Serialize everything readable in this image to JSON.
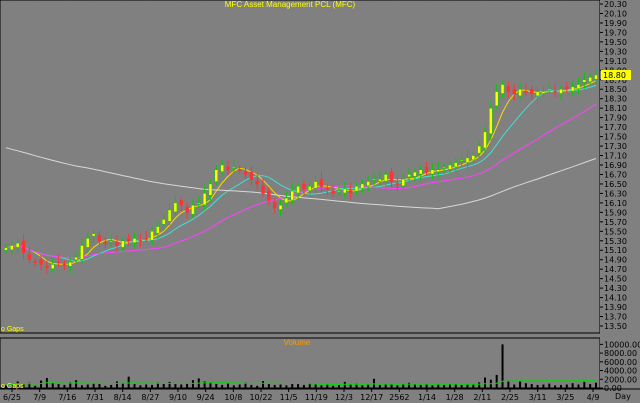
{
  "chart_data": {
    "type": "candlestick",
    "title": "MFC Asset Management PCL (MFC)",
    "price_panel": {
      "ylim": [
        13.5,
        20.3
      ],
      "yticks": [
        "20.30",
        "20.10",
        "19.90",
        "19.70",
        "19.50",
        "19.30",
        "19.10",
        "18.90",
        "18.70",
        "18.50",
        "18.30",
        "18.10",
        "17.90",
        "17.70",
        "17.50",
        "17.30",
        "17.10",
        "16.90",
        "16.70",
        "16.50",
        "16.30",
        "16.10",
        "15.90",
        "15.70",
        "15.50",
        "15.30",
        "15.10",
        "14.90",
        "14.70",
        "14.50",
        "14.30",
        "14.10",
        "13.90",
        "13.70",
        "13.50"
      ],
      "last_price": "18.80",
      "note": "o Gaps",
      "series": [
        {
          "name": "",
          "color": "#ffff00",
          "kind": "candles",
          "values": [
            15.15,
            15.2,
            15.25,
            15.05,
            14.9,
            14.85,
            14.8,
            14.75,
            14.8,
            14.85,
            14.8,
            14.85,
            14.95,
            15.2,
            15.35,
            15.45,
            15.3,
            15.25,
            15.3,
            15.2,
            15.3,
            15.3,
            15.35,
            15.3,
            15.35,
            15.5,
            15.6,
            15.75,
            15.95,
            16.1,
            16.05,
            15.9,
            16.05,
            16.1,
            16.3,
            16.5,
            16.8,
            16.9,
            16.8,
            16.85,
            16.8,
            16.7,
            16.6,
            16.5,
            16.3,
            16.15,
            16.0,
            16.05,
            16.2,
            16.35,
            16.45,
            16.4,
            16.45,
            16.55,
            16.45,
            16.4,
            16.3,
            16.35,
            16.4,
            16.3,
            16.45,
            16.5,
            16.55,
            16.6,
            16.6,
            16.7,
            16.55,
            16.5,
            16.6,
            16.7,
            16.75,
            16.8,
            16.75,
            16.8,
            16.8,
            16.85,
            16.9,
            16.95,
            17.0,
            17.05,
            17.1,
            17.3,
            17.6,
            18.1,
            18.45,
            18.6,
            18.45,
            18.4,
            18.5,
            18.45,
            18.4,
            18.45,
            18.45,
            18.5,
            18.45,
            18.5,
            18.5,
            18.55,
            18.6,
            18.7,
            18.75,
            18.8
          ]
        },
        {
          "name": "",
          "color": "#ffd700",
          "kind": "ma",
          "values": []
        },
        {
          "name": "",
          "color": "#40e0d0",
          "kind": "ma",
          "values": []
        },
        {
          "name": "",
          "color": "#ff40ff",
          "kind": "ma",
          "values": []
        },
        {
          "name": "",
          "color": "#d8d8d8",
          "kind": "ma",
          "values": []
        }
      ]
    },
    "volume_panel": {
      "title": "Volume",
      "ylim": [
        0,
        11000
      ],
      "yticks": [
        "10000.00",
        "8000.00",
        "6000.00",
        "4000.00",
        "2000.00",
        "0.00"
      ],
      "note": "o Gaps",
      "values": [
        600,
        900,
        1500,
        800,
        1200,
        500,
        1700,
        2300,
        1100,
        900,
        700,
        1300,
        1800,
        600,
        800,
        1000,
        900,
        500,
        700,
        1500,
        1100,
        2600,
        900,
        600,
        800,
        700,
        1200,
        1000,
        1400,
        900,
        800,
        1100,
        1800,
        2200,
        1500,
        1300,
        900,
        700,
        1000,
        600,
        800,
        1200,
        700,
        500,
        1600,
        900,
        700,
        800,
        600,
        1000,
        900,
        700,
        1100,
        800,
        600,
        900,
        500,
        700,
        1400,
        900,
        1000,
        600,
        800,
        2100,
        700,
        900,
        800,
        600,
        900,
        1200,
        800,
        700,
        900,
        600,
        800,
        700,
        900,
        1000,
        700,
        800,
        900,
        1300,
        2400,
        1900,
        3000,
        10000,
        1700,
        800,
        1500,
        1100,
        900,
        700,
        800,
        1000,
        600,
        700,
        800,
        1100,
        800,
        1400,
        900,
        1200
      ]
    },
    "x_axis": {
      "label_right": "Day",
      "tick_labels": [
        "6/25",
        "7/9",
        "7/16",
        "7/31",
        "8/14",
        "8/27",
        "9/10",
        "9/24",
        "10/8",
        "10/22",
        "11/5",
        "11/19",
        "12/3",
        "12/17",
        "2562",
        "1/14",
        "1/28",
        "2/11",
        "2/25",
        "3/11",
        "3/25",
        "4/9"
      ]
    }
  }
}
